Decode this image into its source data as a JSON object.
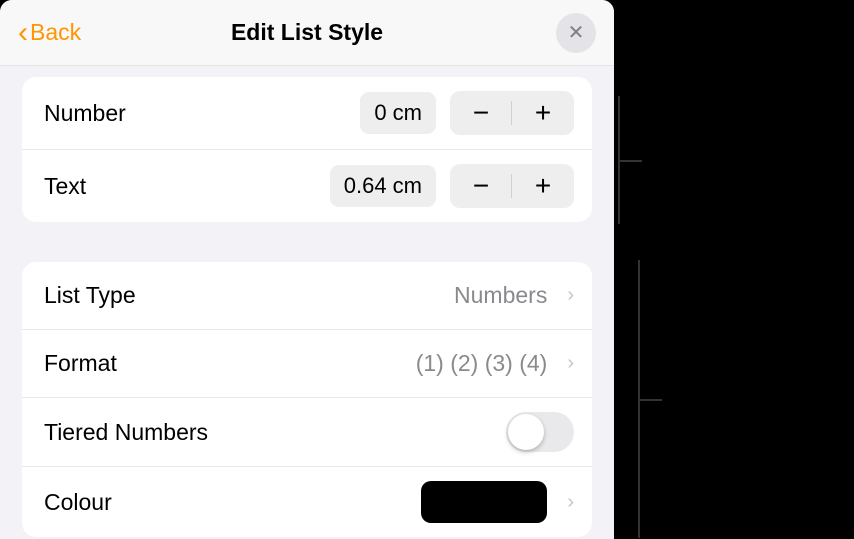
{
  "header": {
    "back_label": "Back",
    "title": "Edit List Style"
  },
  "indent": {
    "number": {
      "label": "Number",
      "value": "0 cm"
    },
    "text": {
      "label": "Text",
      "value": "0.64 cm"
    }
  },
  "list": {
    "type": {
      "label": "List Type",
      "value": "Numbers"
    },
    "format": {
      "label": "Format",
      "value": "(1) (2) (3) (4)"
    },
    "tiered": {
      "label": "Tiered Numbers"
    },
    "colour": {
      "label": "Colour",
      "value": "#000000"
    }
  }
}
